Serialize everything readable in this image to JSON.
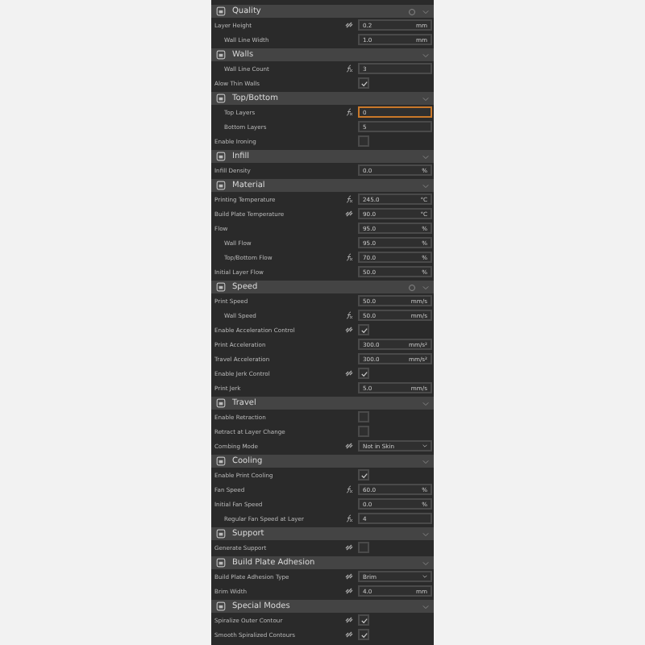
{
  "sections": [
    {
      "title": "Quality",
      "reset_icon": true,
      "settings": [
        {
          "label": "Layer Height",
          "kind": "number",
          "value": "0.2",
          "unit": "mm",
          "indented": false,
          "error": false
        },
        {
          "label": "Wall Line Width",
          "kind": "number",
          "value": "1.0",
          "unit": "mm",
          "indented": true,
          "error": false
        }
      ]
    },
    {
      "title": "Walls",
      "reset_icon": false,
      "settings": [
        {
          "label": "Wall Line Count",
          "kind": "number",
          "value": "3",
          "indented": true,
          "error": false
        },
        {
          "label": "Alow Thin Walls",
          "kind": "checkbox",
          "checked": true,
          "indented": false
        }
      ]
    },
    {
      "title": "Top/Bottom",
      "reset_icon": false,
      "settings": [
        {
          "label": "Top Layers",
          "kind": "number",
          "value": "0",
          "indented": true,
          "error": true
        },
        {
          "label": "Bottom Layers",
          "kind": "number",
          "value": "5",
          "indented": true,
          "error": false
        },
        {
          "label": "Enable Ironing",
          "kind": "checkbox",
          "checked": false,
          "indented": false
        }
      ]
    },
    {
      "title": "Infill",
      "reset_icon": false,
      "settings": [
        {
          "label": "Infill Density",
          "kind": "number",
          "value": "0.0",
          "unit": "%",
          "indented": false,
          "error": false
        }
      ]
    },
    {
      "title": "Material",
      "reset_icon": false,
      "settings": [
        {
          "label": "Printing Temperature",
          "kind": "number",
          "value": "245.0",
          "unit": "°C",
          "indented": false,
          "error": false
        },
        {
          "label": "Build Plate Temperature",
          "kind": "number",
          "value": "90.0",
          "unit": "°C",
          "indented": false,
          "error": false
        },
        {
          "label": "Flow",
          "kind": "number",
          "value": "95.0",
          "unit": "%",
          "indented": false,
          "error": false
        },
        {
          "label": "Wall Flow",
          "kind": "number",
          "value": "95.0",
          "unit": "%",
          "indented": true,
          "error": false
        },
        {
          "label": "Top/Bottom Flow",
          "kind": "number",
          "value": "70.0",
          "unit": "%",
          "indented": true,
          "error": false
        },
        {
          "label": "Initial Layer Flow",
          "kind": "number",
          "value": "50.0",
          "unit": "%",
          "indented": false,
          "error": false
        }
      ]
    },
    {
      "title": "Speed",
      "reset_icon": true,
      "settings": [
        {
          "label": "Print Speed",
          "kind": "number",
          "value": "50.0",
          "unit": "mm/s",
          "indented": false,
          "error": false
        },
        {
          "label": "Wall Speed",
          "kind": "number",
          "value": "50.0",
          "unit": "mm/s",
          "indented": true,
          "error": false
        },
        {
          "label": "Enable Acceleration Control",
          "kind": "checkbox",
          "checked": true,
          "indented": false
        },
        {
          "label": "Print Acceleration",
          "kind": "number",
          "value": "300.0",
          "unit": "mm/s²",
          "indented": false,
          "error": false
        },
        {
          "label": "Travel Acceleration",
          "kind": "number",
          "value": "300.0",
          "unit": "mm/s²",
          "indented": false,
          "error": false
        },
        {
          "label": "Enable Jerk Control",
          "kind": "checkbox",
          "checked": true,
          "indented": false
        },
        {
          "label": "Print Jerk",
          "kind": "number",
          "value": "5.0",
          "unit": "mm/s",
          "indented": false,
          "error": false
        }
      ]
    },
    {
      "title": "Travel",
      "reset_icon": false,
      "settings": [
        {
          "label": "Enable Retraction",
          "kind": "checkbox",
          "checked": false,
          "indented": false
        },
        {
          "label": "Retract at Layer Change",
          "kind": "checkbox",
          "checked": false,
          "indented": false
        },
        {
          "label": "Combing Mode",
          "kind": "dropdown",
          "value": "Not in Skin",
          "indented": false,
          "error": false
        }
      ]
    },
    {
      "title": "Cooling",
      "reset_icon": false,
      "settings": [
        {
          "label": "Enable Print Cooling",
          "kind": "checkbox",
          "checked": true,
          "indented": false
        },
        {
          "label": "Fan Speed",
          "kind": "number",
          "value": "60.0",
          "unit": "%",
          "indented": false,
          "error": false
        },
        {
          "label": "Initial Fan Speed",
          "kind": "number",
          "value": "0.0",
          "unit": "%",
          "indented": false,
          "error": false
        },
        {
          "label": "Regular Fan Speed at Layer",
          "kind": "number",
          "value": "4",
          "indented": true,
          "error": false
        }
      ]
    },
    {
      "title": "Support",
      "reset_icon": false,
      "settings": [
        {
          "label": "Generate Support",
          "kind": "checkbox",
          "checked": false,
          "indented": false
        }
      ]
    },
    {
      "title": "Build Plate Adhesion",
      "reset_icon": false,
      "settings": [
        {
          "label": "Build Plate Adhesion Type",
          "kind": "dropdown",
          "value": "Brim",
          "indented": false,
          "error": false
        },
        {
          "label": "Brim Width",
          "kind": "number",
          "value": "4.0",
          "unit": "mm",
          "indented": false,
          "error": false
        }
      ]
    },
    {
      "title": "Special Modes",
      "reset_icon": false,
      "settings": [
        {
          "label": "Spiralize Outer Contour",
          "kind": "checkbox",
          "checked": true,
          "indented": false
        },
        {
          "label": "Smooth Spiralized Contours",
          "kind": "checkbox",
          "checked": true,
          "indented": false
        }
      ]
    }
  ]
}
